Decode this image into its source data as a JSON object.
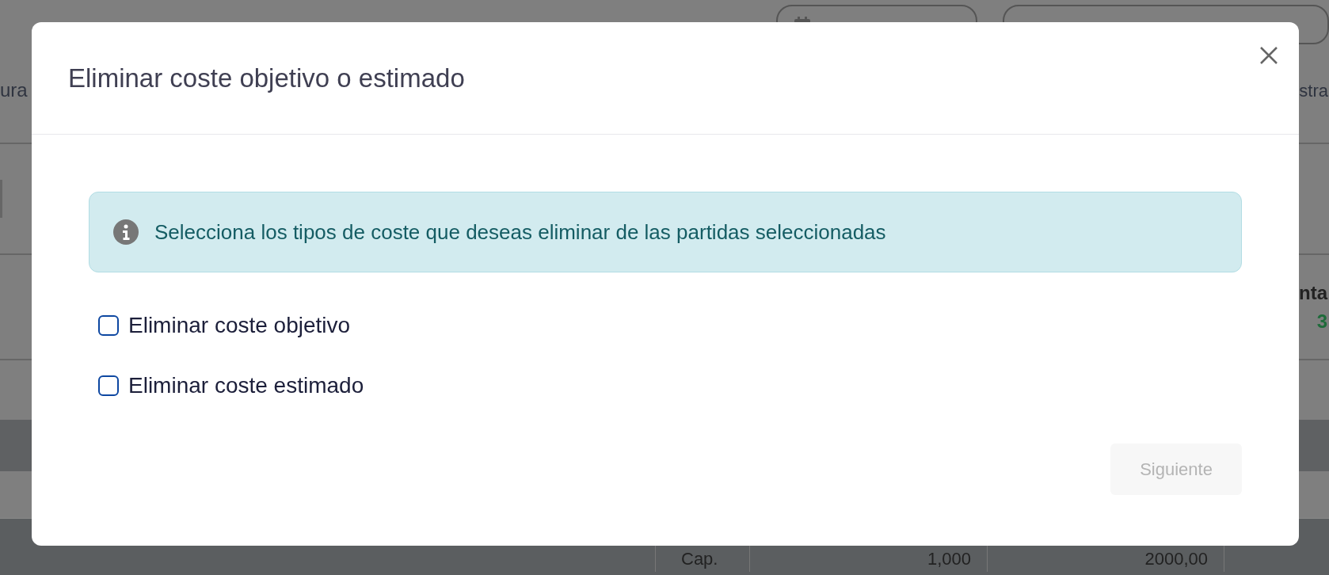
{
  "background": {
    "left_fragment": "ura",
    "right_fragment": "stra",
    "right_heading_fragment": "nta",
    "right_value_fragment": "3",
    "row_cells": [
      "Cap.",
      "1,000",
      "2000,00"
    ]
  },
  "dialog": {
    "title": "Eliminar coste objetivo o estimado",
    "alert": "Selecciona los tipos de coste que deseas eliminar de las partidas seleccionadas",
    "options": [
      {
        "label": "Eliminar coste objetivo",
        "checked": false
      },
      {
        "label": "Eliminar coste estimado",
        "checked": false
      }
    ],
    "next_button": {
      "label": "Siguiente",
      "disabled": true
    }
  }
}
